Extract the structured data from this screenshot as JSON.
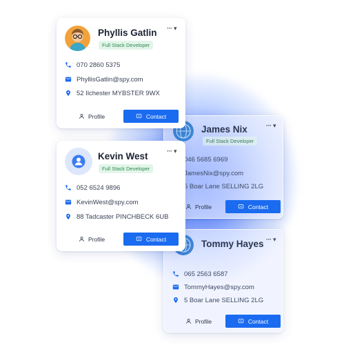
{
  "colors": {
    "accent": "#1a6bf0",
    "icon": "#1a6bf0",
    "badge_text": "#2d8a4e",
    "badge_bg": "#e3f5ea"
  },
  "cards": [
    {
      "name": "Phyllis Gatlin",
      "role": "Full Stack Developer",
      "avatar": "avatar-photo-glasses",
      "phone": "070 2860 5375",
      "email": "PhyllisGatlin@spy.com",
      "address": "52 Ilchester MYBSTER 9WX",
      "profile_label": "Profile",
      "contact_label": "Contact"
    },
    {
      "name": "James Nix",
      "role": "Full Stack Developer",
      "avatar": "avatar-globe",
      "phone": "046 5685 6969",
      "email": "JamesNix@spy.com",
      "address": "5 Boar Lane SELLING 2LG",
      "profile_label": "Profile",
      "contact_label": "Contact"
    },
    {
      "name": "Kevin West",
      "role": "Full Stack Developer",
      "avatar": "avatar-placeholder-user",
      "phone": "052 6524 9896",
      "email": "KevinWest@spy.com",
      "address": "88 Tadcaster PINCHBECK 6UB",
      "profile_label": "Profile",
      "contact_label": "Contact"
    },
    {
      "name": "Tommy Hayes",
      "avatar": "avatar-globe",
      "phone": "065 2563 6587",
      "email": "TommyHayes@spy.com",
      "address": "5 Boar Lane SELLING 2LG",
      "profile_label": "Profile",
      "contact_label": "Contact"
    }
  ]
}
